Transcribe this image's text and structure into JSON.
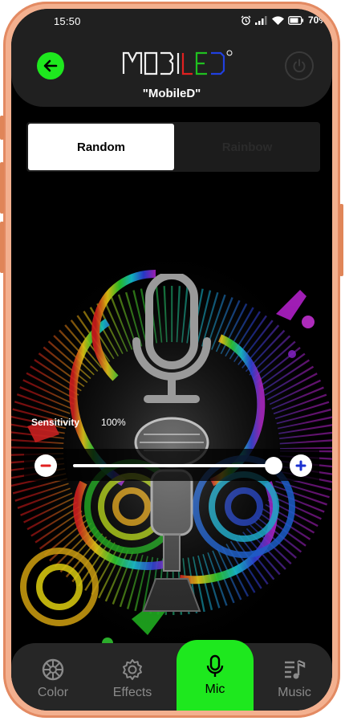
{
  "status_bar": {
    "time": "15:50",
    "battery": "70%"
  },
  "header": {
    "device_name": "\"MobileD\"",
    "logo_text": "MOBILED"
  },
  "mode_tabs": [
    {
      "label": "Random",
      "active": true
    },
    {
      "label": "Rainbow",
      "active": false
    }
  ],
  "sensitivity": {
    "label": "Sensitivity",
    "value_text": "100%",
    "value": 1.0
  },
  "bottom_nav": [
    {
      "label": "Color",
      "icon": "color-wheel-icon",
      "active": false
    },
    {
      "label": "Effects",
      "icon": "gear-icon",
      "active": false
    },
    {
      "label": "Mic",
      "icon": "microphone-icon",
      "active": true
    },
    {
      "label": "Music",
      "icon": "music-list-icon",
      "active": false
    }
  ],
  "colors": {
    "accent": "#1ee81e",
    "background": "#000000",
    "panel": "#202020",
    "frame": "#f3b08f"
  }
}
